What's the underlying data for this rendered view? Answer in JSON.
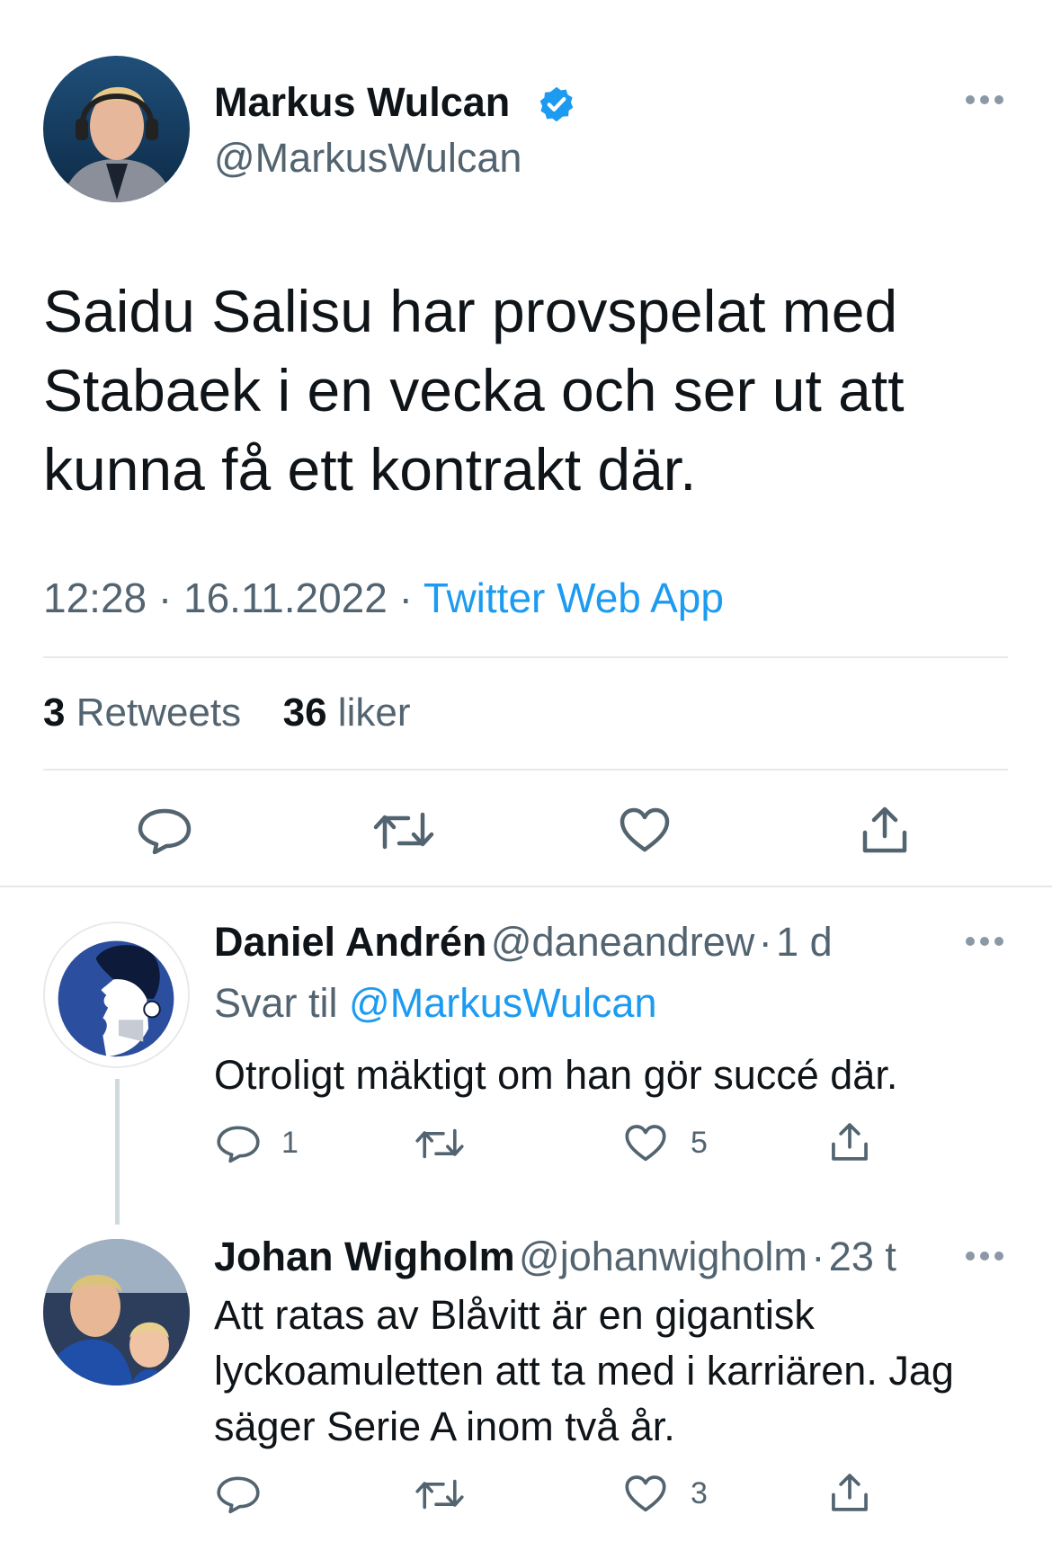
{
  "main_tweet": {
    "author_name": "Markus Wulcan",
    "author_handle": "@MarkusWulcan",
    "text": "Saidu Salisu har provspelat med Stabaek i en vecka och ser ut att kunna få ett kontrakt där.",
    "time": "12:28",
    "date": "16.11.2022",
    "source": "Twitter Web App",
    "retweets_count": "3",
    "retweets_label": "Retweets",
    "likes_count": "36",
    "likes_label": "liker"
  },
  "replies": [
    {
      "author_name": "Daniel Andrén",
      "author_handle": "@daneandrew",
      "age": "1 d",
      "reply_to_label": "Svar til",
      "reply_to_handle": "@MarkusWulcan",
      "text": "Otroligt mäktigt om han gör succé där.",
      "reply_count": "1",
      "retweet_count": "",
      "like_count": "5"
    },
    {
      "author_name": "Johan Wigholm",
      "author_handle": "@johanwigholm",
      "age": "23 t",
      "text": "Att ratas av Blåvitt är en gigantisk lyckoamuletten att ta med i karriären. Jag säger Serie A inom två år.",
      "reply_count": "",
      "retweet_count": "",
      "like_count": "3"
    }
  ],
  "icons": {
    "verified": "verified-badge-icon",
    "more": "more-dots-icon",
    "reply": "reply-bubble-icon",
    "retweet": "retweet-arrows-icon",
    "like": "heart-icon",
    "share": "share-upload-icon"
  },
  "colors": {
    "accent": "#1d9bf0",
    "muted": "#536471",
    "text": "#0f1419"
  }
}
